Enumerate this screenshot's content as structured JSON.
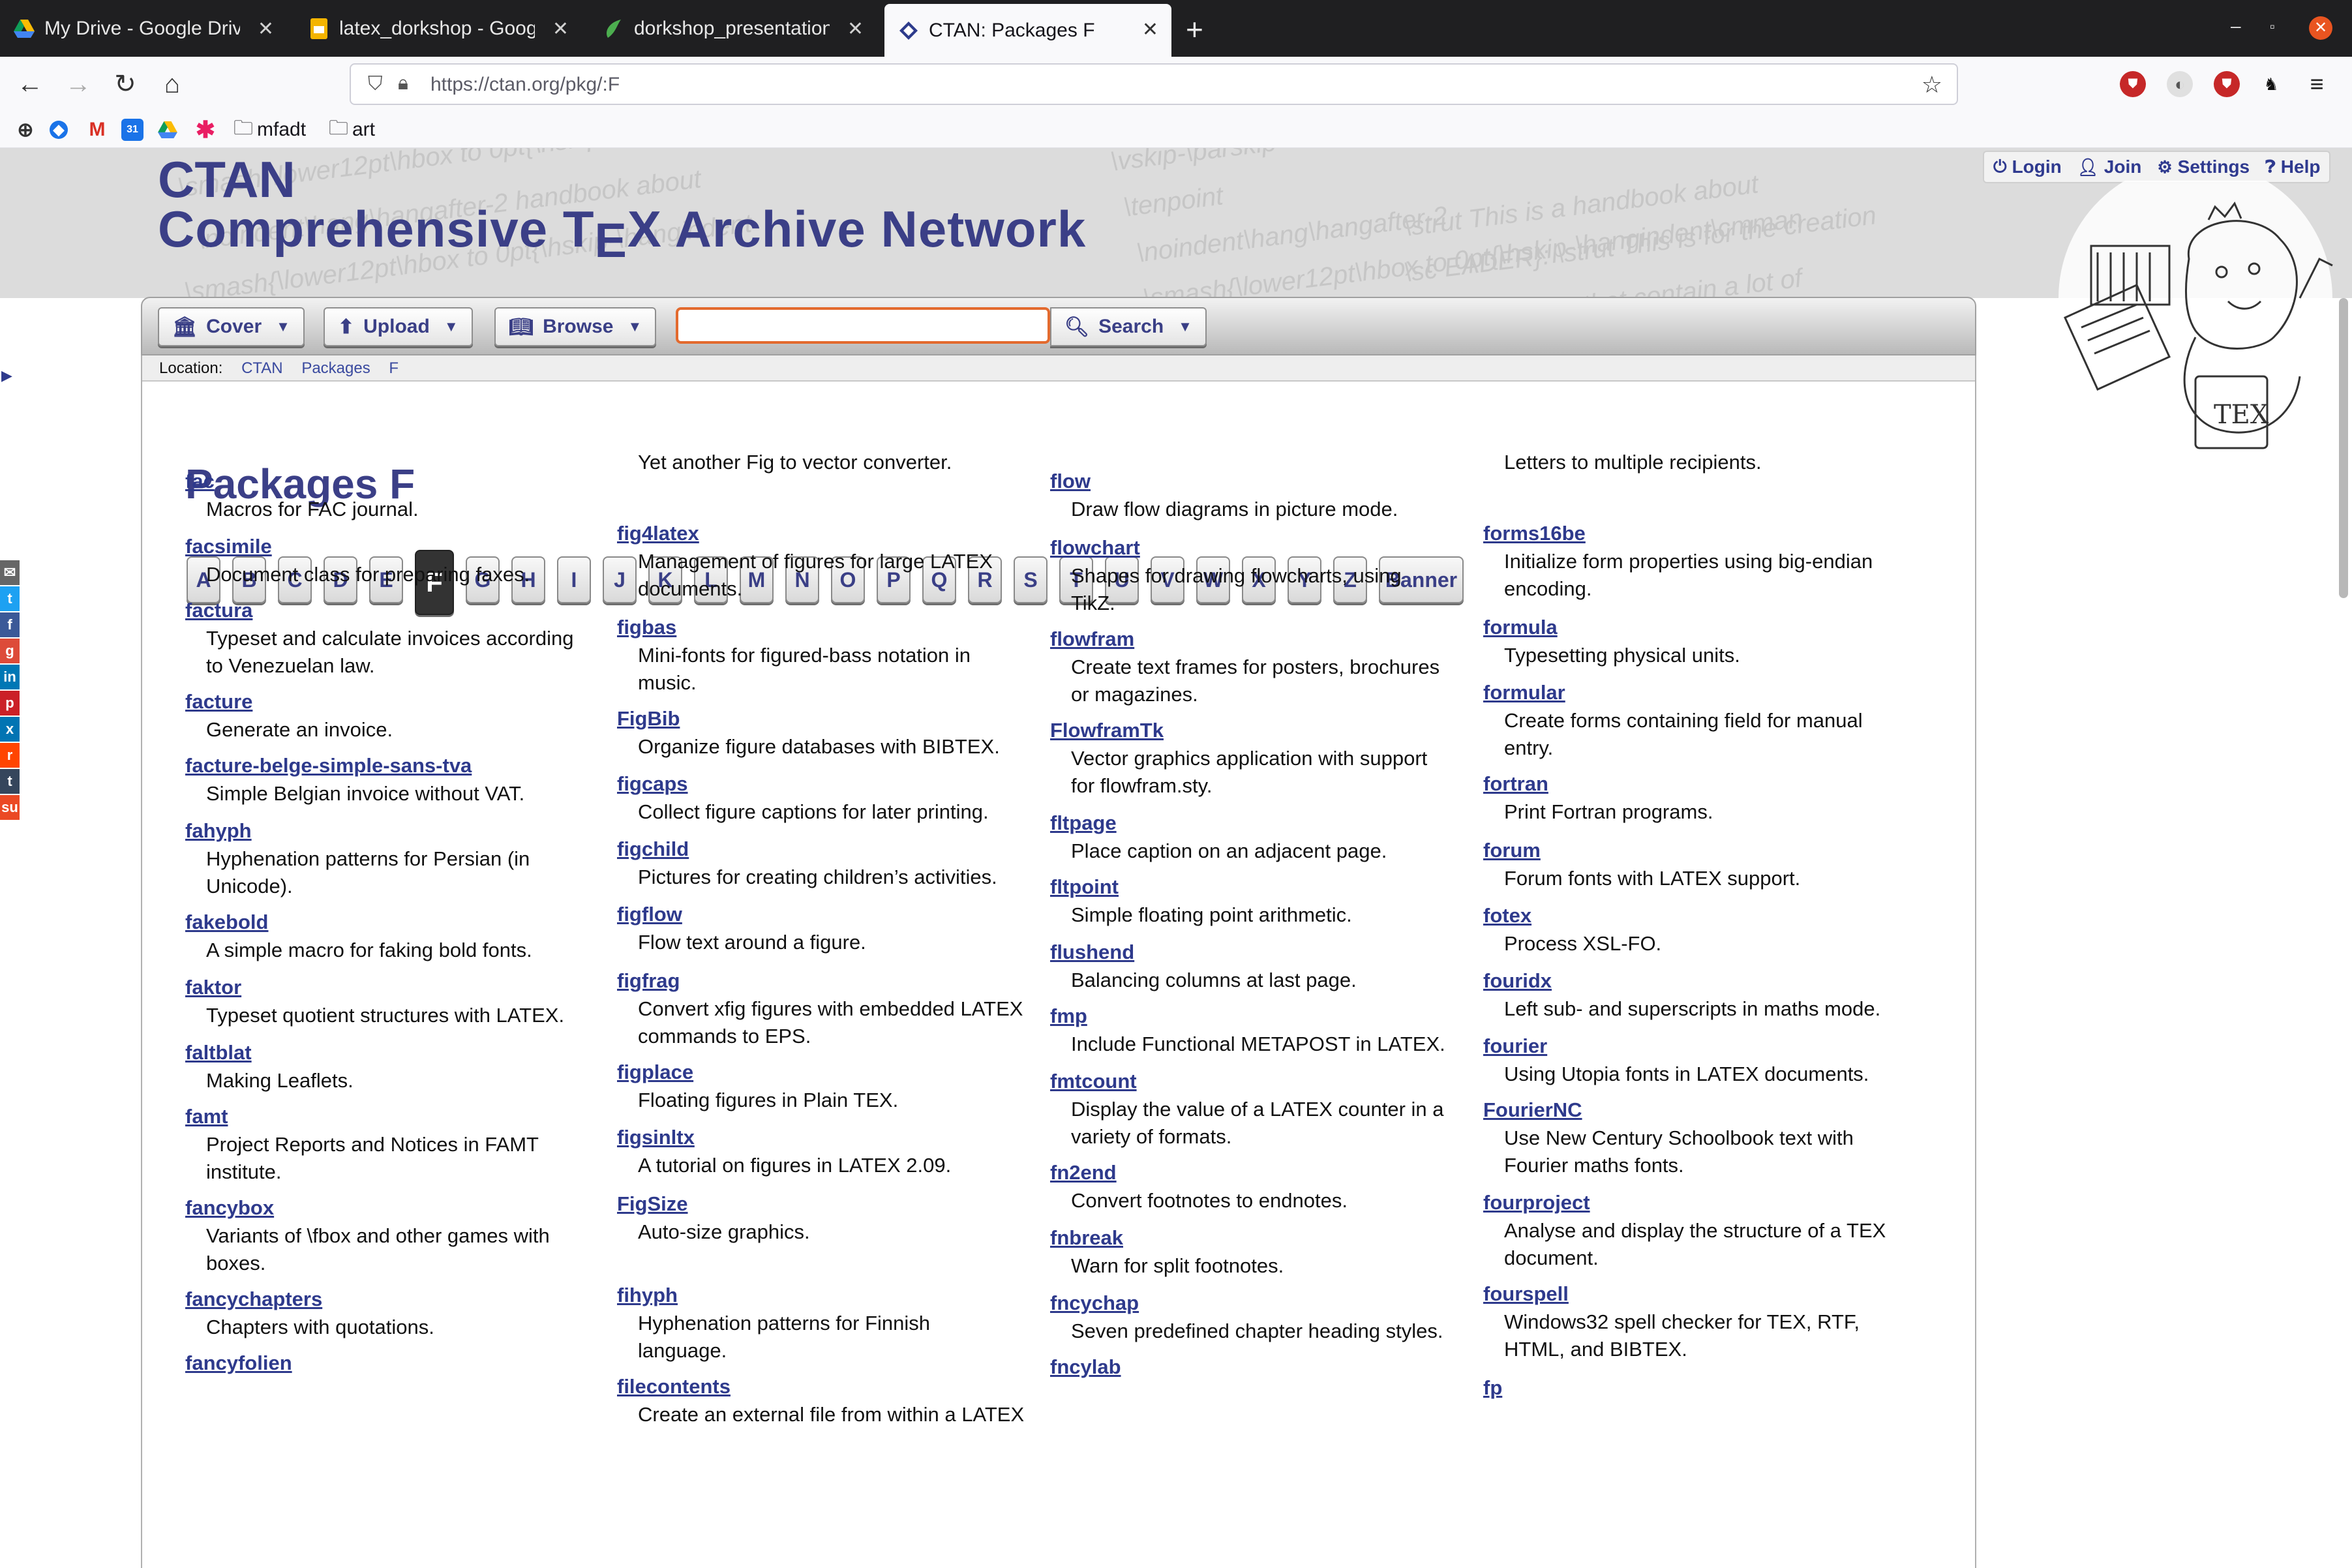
{
  "browser": {
    "tabs": [
      {
        "title": "My Drive - Google Drive",
        "icon": "google-drive-icon",
        "active": false
      },
      {
        "title": "latex_dorkshop - Google",
        "icon": "google-slides-icon",
        "active": false
      },
      {
        "title": "dorkshop_presentation -",
        "icon": "overleaf-icon",
        "active": false
      },
      {
        "title": "CTAN: Packages F",
        "icon": "ctan-icon",
        "active": true
      }
    ],
    "url": "https://ctan.org/pkg/:F",
    "bookmarks": [
      "mfadt",
      "art"
    ]
  },
  "header": {
    "title_line1": "CTAN",
    "title_line2_a": "Comprehensive T",
    "title_line2_e": "E",
    "title_line2_b": "X Archive Network",
    "links": [
      "Login",
      "Join",
      "Settings",
      "Help"
    ]
  },
  "menu": {
    "cover": "Cover",
    "upload": "Upload",
    "browse": "Browse",
    "search": "Search",
    "search_value": ""
  },
  "location": {
    "label": "Location:",
    "crumbs": [
      "CTAN",
      "Packages",
      "F"
    ]
  },
  "page_title": "Packages F",
  "letters": [
    "A",
    "B",
    "C",
    "D",
    "E",
    "F",
    "G",
    "H",
    "I",
    "J",
    "K",
    "L",
    "M",
    "N",
    "O",
    "P",
    "Q",
    "R",
    "S",
    "T",
    "U",
    "V",
    "W",
    "X",
    "Y",
    "Z",
    "Banner"
  ],
  "active_letter": "F",
  "columns": [
    [
      {
        "name": "fac",
        "desc": [
          "Macros for FAC journal."
        ]
      },
      {
        "name": "facsimile",
        "desc": [
          "Document class for preparing faxes."
        ]
      },
      {
        "name": "factura",
        "desc": [
          "Typeset and calculate invoices according",
          "to Venezuelan law."
        ]
      },
      {
        "name": "facture",
        "desc": [
          "Generate an invoice."
        ]
      },
      {
        "name": "facture-belge-simple-sans-tva",
        "desc": [
          "Simple Belgian invoice without VAT."
        ]
      },
      {
        "name": "fahyph",
        "desc": [
          "Hyphenation patterns for Persian (in",
          "Unicode)."
        ]
      },
      {
        "name": "fakebold",
        "desc": [
          "A simple macro for faking bold fonts."
        ]
      },
      {
        "name": "faktor",
        "desc": [
          "Typeset quotient structures with LATEX."
        ]
      },
      {
        "name": "faltblat",
        "desc": [
          "Making Leaflets."
        ]
      },
      {
        "name": "famt",
        "desc": [
          "Project Reports and Notices in FAMT",
          "institute."
        ]
      },
      {
        "name": "fancybox",
        "desc": [
          "Variants of \\fbox and other games with",
          "boxes."
        ]
      },
      {
        "name": "fancychapters",
        "desc": [
          "Chapters with quotations."
        ]
      },
      {
        "name": "fancyfolien",
        "desc": []
      }
    ],
    [
      {
        "name": "",
        "desc": [
          "Yet another Fig to vector converter."
        ]
      },
      {
        "name": "fig4latex",
        "desc": [
          "Management of figures for large LATEX",
          "documents."
        ]
      },
      {
        "name": "figbas",
        "desc": [
          "Mini-fonts for figured-bass notation in",
          "music."
        ]
      },
      {
        "name": "FigBib",
        "desc": [
          "Organize figure databases with BIBTEX."
        ]
      },
      {
        "name": "figcaps",
        "desc": [
          "Collect figure captions for later printing."
        ]
      },
      {
        "name": "figchild",
        "desc": [
          "Pictures for creating children’s activities."
        ]
      },
      {
        "name": "figflow",
        "desc": [
          "Flow text around a figure."
        ]
      },
      {
        "name": "figfrag",
        "desc": [
          "Convert xfig figures with embedded LATEX",
          "commands to EPS."
        ]
      },
      {
        "name": "figplace",
        "desc": [
          "Floating figures in Plain TEX."
        ]
      },
      {
        "name": "figsinltx",
        "desc": [
          "A tutorial on figures in LATEX 2.09."
        ]
      },
      {
        "name": "FigSize",
        "desc": [
          "Auto-size graphics."
        ]
      },
      {
        "name": "fihyph",
        "desc": [
          "Hyphenation patterns for Finnish",
          "language."
        ]
      },
      {
        "name": "filecontents",
        "desc": [
          "Create an external file from within a LATEX"
        ]
      }
    ],
    [
      {
        "name": "flow",
        "desc": [
          "Draw flow diagrams in picture mode."
        ]
      },
      {
        "name": "flowchart",
        "desc": [
          "Shapes for drawing flowcharts, using",
          "TikZ."
        ]
      },
      {
        "name": "flowfram",
        "desc": [
          "Create text frames for posters, brochures",
          "or magazines."
        ]
      },
      {
        "name": "FlowframTk",
        "desc": [
          "Vector graphics application with support",
          "for flowfram.sty."
        ]
      },
      {
        "name": "fltpage",
        "desc": [
          "Place caption on an adjacent page."
        ]
      },
      {
        "name": "fltpoint",
        "desc": [
          "Simple floating point arithmetic."
        ]
      },
      {
        "name": "flushend",
        "desc": [
          "Balancing columns at last page."
        ]
      },
      {
        "name": "fmp",
        "desc": [
          "Include Functional METAPOST in LATEX."
        ]
      },
      {
        "name": "fmtcount",
        "desc": [
          "Display the value of a LATEX counter in a",
          "variety of formats."
        ]
      },
      {
        "name": "fn2end",
        "desc": [
          "Convert footnotes to endnotes."
        ]
      },
      {
        "name": "fnbreak",
        "desc": [
          "Warn for split footnotes."
        ]
      },
      {
        "name": "fncychap",
        "desc": [
          "Seven predefined chapter heading styles."
        ]
      },
      {
        "name": "fncylab",
        "desc": []
      }
    ],
    [
      {
        "name": "",
        "desc": [
          "Letters to multiple recipients."
        ]
      },
      {
        "name": "forms16be",
        "desc": [
          "Initialize form properties using big-endian",
          "encoding."
        ]
      },
      {
        "name": "formula",
        "desc": [
          "Typesetting physical units."
        ]
      },
      {
        "name": "formular",
        "desc": [
          "Create forms containing field for manual",
          "entry."
        ]
      },
      {
        "name": "fortran",
        "desc": [
          "Print Fortran programs."
        ]
      },
      {
        "name": "forum",
        "desc": [
          "Forum fonts with LATEX support."
        ]
      },
      {
        "name": "fotex",
        "desc": [
          "Process XSL-FO."
        ]
      },
      {
        "name": "fouridx",
        "desc": [
          "Left sub- and superscripts in maths mode."
        ]
      },
      {
        "name": "fourier",
        "desc": [
          "Using Utopia fonts in LATEX documents."
        ]
      },
      {
        "name": "FourierNC",
        "desc": [
          "Use New Century Schoolbook text with",
          "Fourier maths fonts."
        ]
      },
      {
        "name": "fourproject",
        "desc": [
          "Analyse and display the structure of a TEX",
          "document."
        ]
      },
      {
        "name": "fourspell",
        "desc": [
          "Windows32 spell checker for TEX, RTF,",
          "HTML, and BIBTEX."
        ]
      },
      {
        "name": "fp",
        "desc": []
      }
    ]
  ]
}
